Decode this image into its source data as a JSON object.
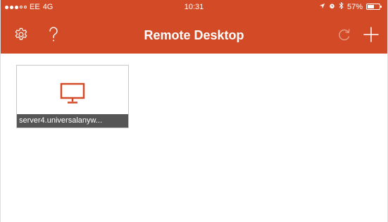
{
  "status_bar": {
    "carrier": "EE",
    "network": "4G",
    "time": "10:31",
    "battery": "57%",
    "battery_level": 0.57,
    "signal_bars_filled": 3,
    "signal_bars_total": 5,
    "icons": [
      "signal-dots-icon",
      "location-arrow-icon",
      "alarm-icon",
      "bluetooth-icon",
      "battery-icon"
    ]
  },
  "nav": {
    "title": "Remote Desktop",
    "left_buttons": [
      "settings-icon",
      "help-icon"
    ],
    "right_buttons": [
      "refresh-icon",
      "add-icon"
    ]
  },
  "desktops": [
    {
      "label": "server4.universalanyw...",
      "icon": "monitor-icon"
    }
  ],
  "colors": {
    "accent": "#d34b26",
    "tile_label_bg": "#555555",
    "tile_border": "#c9c9c9",
    "background": "#ffffff"
  }
}
